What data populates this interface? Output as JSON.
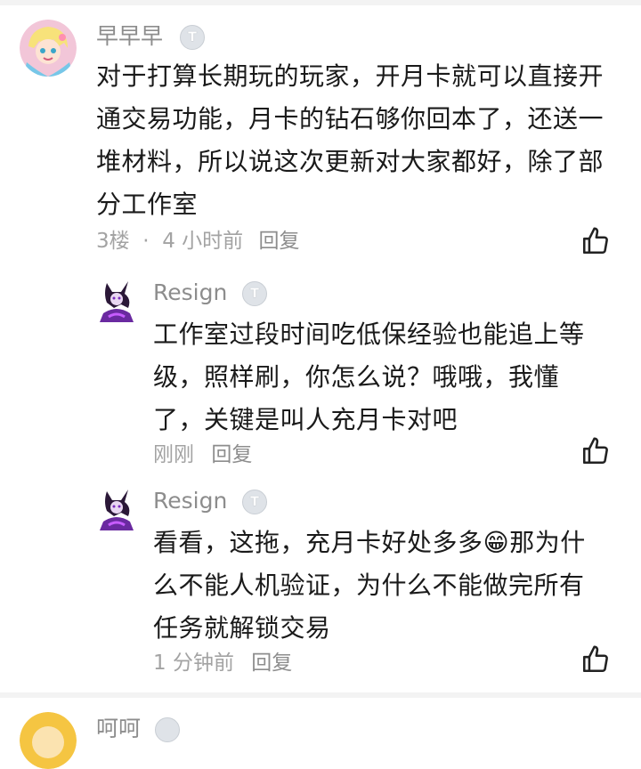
{
  "comments": [
    {
      "username": "早早早",
      "level_badge": "T",
      "text": "对于打算长期玩的玩家，开月卡就可以直接开通交易功能，月卡的钻石够你回本了，还送一堆材料，所以说这次更新对大家都好，除了部分工作室",
      "floor": "3楼",
      "time": "4 小时前",
      "reply_label": "回复"
    },
    {
      "username": "Resign",
      "level_badge": "T",
      "text": "工作室过段时间吃低保经验也能追上等级，照样刷，你怎么说？哦哦，我懂了，关键是叫人充月卡对吧",
      "time": "刚刚",
      "reply_label": "回复"
    },
    {
      "username": "Resign",
      "level_badge": "T",
      "text": "看看，这拖，充月卡好处多多😁那为什么不能人机验证，为什么不能做完所有任务就解锁交易",
      "time": "1 分钟前",
      "reply_label": "回复"
    },
    {
      "username": "呵呵"
    }
  ],
  "colors": {
    "meta_text": "#a3a3a3",
    "username_text": "#8d8d8d",
    "divider": "#f3f3f3"
  },
  "icons": {
    "like": "thumbs-up-icon",
    "level": "level-badge-icon"
  }
}
